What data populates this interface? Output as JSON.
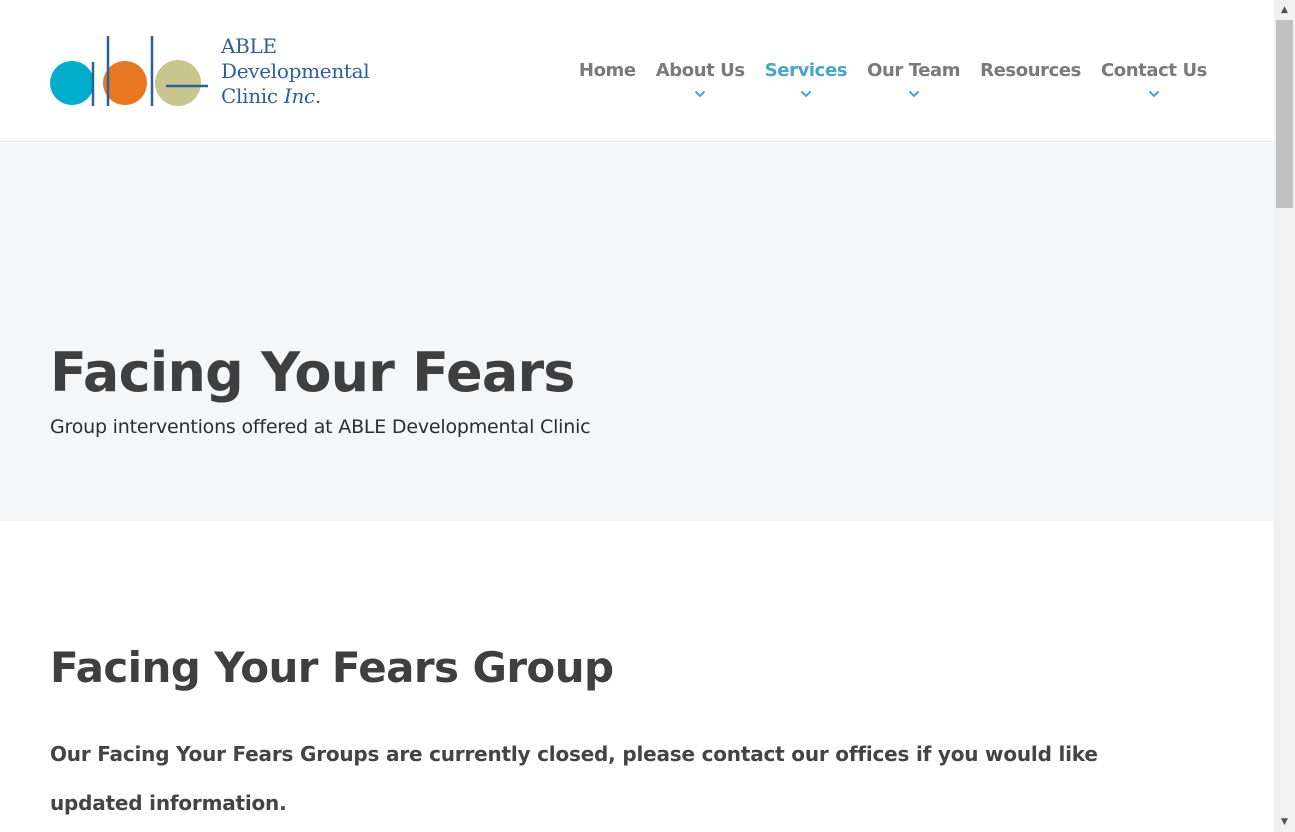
{
  "logo": {
    "line1": "ABLE",
    "line2": "Developmental",
    "line3_a": "Clinic ",
    "line3_b": "Inc.",
    "colors": {
      "teal": "#00aecb",
      "orange": "#e87722",
      "olive": "#c9c58e",
      "blue": "#2f5f9a"
    }
  },
  "nav": {
    "items": [
      {
        "label": "Home",
        "has_dropdown": false,
        "active": false
      },
      {
        "label": "About Us",
        "has_dropdown": true,
        "active": false
      },
      {
        "label": "Services",
        "has_dropdown": true,
        "active": true
      },
      {
        "label": "Our Team",
        "has_dropdown": true,
        "active": false
      },
      {
        "label": "Resources",
        "has_dropdown": false,
        "active": false
      },
      {
        "label": "Contact Us",
        "has_dropdown": true,
        "active": false
      }
    ],
    "chevron_icon": "chevron-down-icon",
    "accent_color": "#4aa3c9"
  },
  "hero": {
    "title": "Facing Your Fears",
    "subtitle": "Group interventions offered at ABLE Developmental Clinic"
  },
  "content": {
    "heading": "Facing Your Fears Group",
    "body": "Our Facing Your Fears Groups are currently closed, please contact our offices if you would like updated information."
  },
  "scrollbar": {
    "up_icon": "scroll-up-arrow-icon",
    "down_icon": "scroll-down-arrow-icon"
  }
}
